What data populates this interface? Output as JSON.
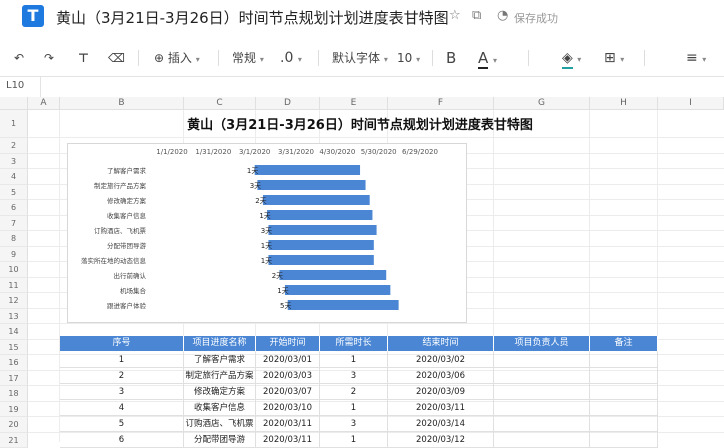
{
  "app": {
    "doc_title": "黄山（3月21日-3月26日）时间节点规划计划进度表甘特图",
    "save_status": "保存成功"
  },
  "toolbar": {
    "insert_label": "插入",
    "format_label": "常规",
    "decimal_label": ".0",
    "font_label": "默认字体",
    "size_label": "10",
    "bold_label": "B",
    "font_color_label": "A",
    "colors": {
      "accent": "#4a86d4",
      "font_color_bar": "#222222",
      "fill_bar": "#20a0a0"
    }
  },
  "formula_bar": {
    "cell_ref": "L10"
  },
  "columns": [
    "A",
    "B",
    "C",
    "D",
    "E",
    "F",
    "G",
    "H",
    "I"
  ],
  "rows": [
    "1",
    "2",
    "3",
    "4",
    "5",
    "6",
    "7",
    "8",
    "9",
    "10",
    "11",
    "12",
    "13",
    "14",
    "15",
    "16",
    "17",
    "18",
    "19",
    "20",
    "21"
  ],
  "sheet": {
    "title": "黄山（3月21日-3月26日）时间节点规划计划进度表甘特图"
  },
  "chart_data": {
    "type": "bar",
    "orientation": "horizontal-gantt",
    "x_ticks": [
      "1/1/2020",
      "1/31/2020",
      "3/1/2020",
      "3/31/2020",
      "4/30/2020",
      "5/30/2020",
      "6/29/2020"
    ],
    "x_tick_values": [
      "2020-01-01",
      "2020-01-31",
      "2020-03-01",
      "2020-03-31",
      "2020-04-30",
      "2020-05-30",
      "2020-06-29"
    ],
    "categories": [
      "了解客户需求",
      "制定旅行产品方案",
      "修改确定方案",
      "收集客户信息",
      "订购酒店、飞机票",
      "分配带团导游",
      "落实所在地的动态信息",
      "出行前确认",
      "机场集合",
      "跟进客户体验"
    ],
    "start": [
      "2020-03-01",
      "2020-03-03",
      "2020-03-07",
      "2020-03-10",
      "2020-03-11",
      "2020-03-11",
      "2020-03-11",
      "2020-03-19",
      "2020-03-23",
      "2020-03-25"
    ],
    "duration_days": [
      1,
      3,
      2,
      1,
      3,
      1,
      1,
      2,
      1,
      5
    ],
    "bar_labels": [
      "1天",
      "3天",
      "2天",
      "1天",
      "3天",
      "1天",
      "1天",
      "2天",
      "1天",
      "5天"
    ],
    "color": "#4a86d4"
  },
  "table": {
    "headers": [
      "序号",
      "项目进度名称",
      "开始时间",
      "所需时长",
      "结束时间",
      "项目负责人员",
      "备注"
    ],
    "rows": [
      [
        "1",
        "了解客户需求",
        "2020/03/01",
        "1",
        "2020/03/02",
        "",
        ""
      ],
      [
        "2",
        "制定旅行产品方案",
        "2020/03/03",
        "3",
        "2020/03/06",
        "",
        ""
      ],
      [
        "3",
        "修改确定方案",
        "2020/03/07",
        "2",
        "2020/03/09",
        "",
        ""
      ],
      [
        "4",
        "收集客户信息",
        "2020/03/10",
        "1",
        "2020/03/11",
        "",
        ""
      ],
      [
        "5",
        "订购酒店、飞机票",
        "2020/03/11",
        "3",
        "2020/03/14",
        "",
        ""
      ],
      [
        "6",
        "分配带团导游",
        "2020/03/11",
        "1",
        "2020/03/12",
        "",
        ""
      ]
    ]
  }
}
